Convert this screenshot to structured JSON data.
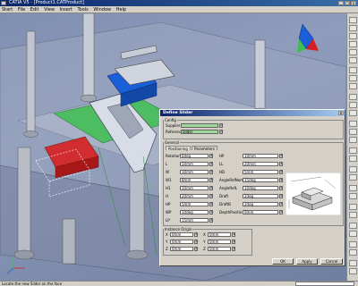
{
  "app": {
    "title": "CATIA V5 - [Product1.CATProduct]",
    "window_buttons": [
      "_",
      "□",
      "×"
    ]
  },
  "menu": {
    "items": [
      "Start",
      "File",
      "Edit",
      "View",
      "Insert",
      "Tools",
      "Window",
      "Help"
    ]
  },
  "dialog": {
    "title": "Define Slider",
    "close_label": "×",
    "config": {
      "legend": "Config",
      "supplier_label": "Supplier",
      "supplier_value": "",
      "reference_label": "Reference",
      "reference_value": "Slider"
    },
    "params": {
      "legend": "General",
      "tabs": [
        "Positioning",
        "Parameters"
      ],
      "left_fields": [
        {
          "label": "Rotation",
          "value": "0deg"
        },
        {
          "label": "L",
          "value": "50mm"
        },
        {
          "label": "W",
          "value": "30mm"
        },
        {
          "label": "W1",
          "value": "8mm"
        },
        {
          "label": "H1",
          "value": "10mm"
        },
        {
          "label": "H",
          "value": "20mm"
        },
        {
          "label": "HP",
          "value": "5mm"
        },
        {
          "label": "WP",
          "value": "10deg"
        },
        {
          "label": "LP",
          "value": "15mm"
        }
      ],
      "right_fields": [
        {
          "label": "HP",
          "value": "10mm"
        },
        {
          "label": "LL",
          "value": "20mm"
        },
        {
          "label": "HD",
          "value": "5mm"
        },
        {
          "label": "AngleRefNom",
          "value": "15deg"
        },
        {
          "label": "AngleRefL",
          "value": "10deg"
        },
        {
          "label": "Draft",
          "value": "2deg"
        },
        {
          "label": "DraftB",
          "value": "2deg"
        },
        {
          "label": "DepthPositio",
          "value": "0mm"
        }
      ]
    },
    "instance": {
      "legend": "Instance Origin",
      "rows": [
        {
          "label": "X",
          "value": "0mm",
          "label2": "X",
          "value2": "0mm"
        },
        {
          "label": "Y",
          "value": "0mm",
          "label2": "Y",
          "value2": "0mm"
        },
        {
          "label": "Z",
          "value": "0mm",
          "label2": "Z",
          "value2": "0mm"
        }
      ]
    },
    "buttons": {
      "ok": "OK",
      "apply": "Apply",
      "cancel": "Cancel"
    }
  },
  "status": {
    "message": "Locate the new Slider on the face"
  },
  "colors": {
    "accent_green": "#3fbf4f",
    "accent_red": "#d82020",
    "accent_blue": "#1a5fd8",
    "field_green": "#9ed89e"
  }
}
